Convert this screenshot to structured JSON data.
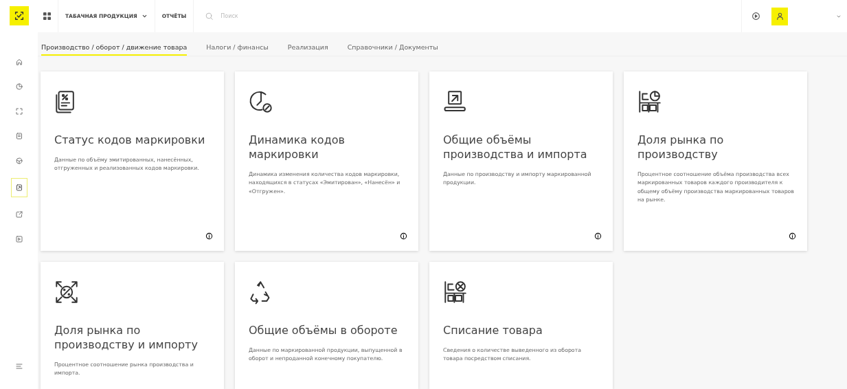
{
  "header": {
    "product_menu": "ТАБАЧНАЯ ПРОДУКЦИЯ",
    "reports": "ОТЧЁТЫ",
    "search": {
      "placeholder": "Поиск"
    }
  },
  "sidebar": {
    "items": [
      {
        "kind": "home",
        "selected": false
      },
      {
        "kind": "pie",
        "selected": false
      },
      {
        "kind": "scan",
        "selected": false
      },
      {
        "kind": "document",
        "selected": false
      },
      {
        "kind": "globe",
        "selected": false
      },
      {
        "kind": "chart",
        "selected": true
      },
      {
        "kind": "external",
        "selected": false
      },
      {
        "kind": "play",
        "selected": false
      }
    ]
  },
  "tabs": [
    {
      "label": "Производство / оборот / движение товара",
      "selected": true
    },
    {
      "label": "Налоги / финансы",
      "selected": false
    },
    {
      "label": "Реализация",
      "selected": false
    },
    {
      "label": "Справочники / Документы",
      "selected": false
    }
  ],
  "cards": [
    {
      "kind": "doc-percent",
      "title": "Статус кодов маркировки",
      "description": "Данные по объёму эмитированных, нанесённых, отгруженных и реализованных кодов маркировки.",
      "info_button": true
    },
    {
      "kind": "clock-percent",
      "title": "Динамика кодов маркировки",
      "description": "Динамика изменения количества кодов маркировки, находящихся в статусах «Эмитирован», «Нанесён» и «Отгружен».",
      "info_button": true
    },
    {
      "kind": "conveyor",
      "title": "Общие объёмы производства и импорта",
      "description": "Данные по производству и импорту маркированной продукции.",
      "info_button": true
    },
    {
      "kind": "boxes-chart",
      "title": "Доля рынка по производству",
      "description": "Процентное соотношение объёма производства всех маркированных товаров каждого производителя к общему объёму производства маркированных товаров на рынке.",
      "info_button": true
    },
    {
      "kind": "arrows-percent",
      "title": "Доля рынка по производству и импорту",
      "description": "Процентное соотношение рынка производства и импорта.",
      "info_button": false
    },
    {
      "kind": "recycle",
      "title": "Общие объёмы в обороте",
      "description": "Данные по маркированной продукции, выпущенной в оборот и непроданной конечному покупателю.",
      "info_button": false
    },
    {
      "kind": "boxes-x",
      "title": "Списание товара",
      "description": "Сведения о количестве выведенного из оборота товара посредством списания.",
      "info_button": false
    }
  ]
}
